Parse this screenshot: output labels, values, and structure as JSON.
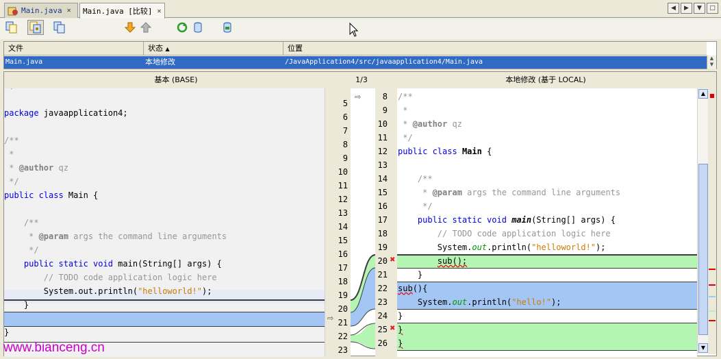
{
  "tabs": [
    {
      "label": "Main.java",
      "active": false
    },
    {
      "label": "Main.java [比较]",
      "active": true
    }
  ],
  "file_table": {
    "columns": [
      "文件",
      "状态",
      "位置"
    ],
    "sort_indicator": "▲",
    "rows": [
      {
        "file": "Main.java",
        "status": "本地修改",
        "location": "/JavaApplication4/src/javaapplication4/Main.java"
      }
    ]
  },
  "diff": {
    "left_title": "基本 (BASE)",
    "right_title": "本地修改 (基于 LOCAL)",
    "counter": "1/3",
    "left_numbers": [
      "5",
      "6",
      "7",
      "8",
      "9",
      "10",
      "11",
      "12",
      "13",
      "14",
      "15",
      "16",
      "17",
      "18",
      "19",
      "20",
      "21",
      "22",
      "23"
    ],
    "right_numbers": [
      "8",
      "9",
      "10",
      "11",
      "12",
      "13",
      "14",
      "15",
      "16",
      "17",
      "18",
      "19",
      "20",
      "21",
      "22",
      "23",
      "24",
      "25",
      "26"
    ]
  },
  "colors": {
    "added": "#b4f5b4",
    "changed": "#a3c6f5",
    "selection": "#316ac5",
    "error": "#e00000"
  },
  "watermark": "www.bianceng.cn"
}
